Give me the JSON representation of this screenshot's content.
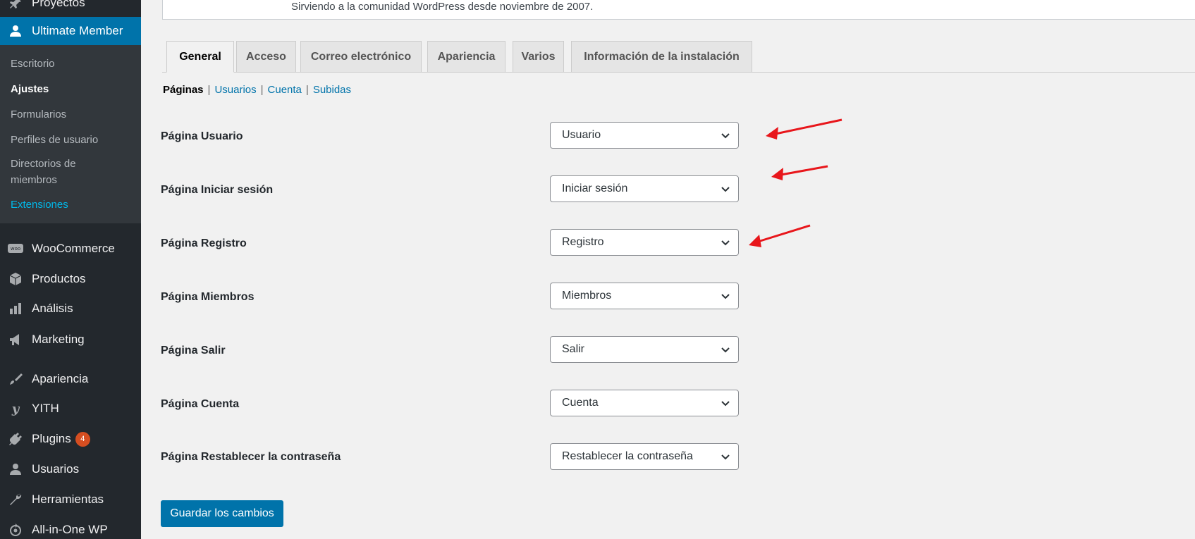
{
  "sidebar": {
    "top_items": [
      {
        "label": "Proyectos",
        "icon": "pin-icon"
      },
      {
        "label": "Ultimate Member",
        "icon": "user-icon"
      }
    ],
    "submenu": [
      {
        "label": "Escritorio"
      },
      {
        "label": "Ajustes"
      },
      {
        "label": "Formularios"
      },
      {
        "label": "Perfiles de usuario"
      },
      {
        "label": "Directorios de"
      },
      {
        "label": "miembros"
      },
      {
        "label": "Extensiones"
      }
    ],
    "items": [
      {
        "label": "WooCommerce",
        "icon": "woo-icon"
      },
      {
        "label": "Productos",
        "icon": "box-icon"
      },
      {
        "label": "Análisis",
        "icon": "bar-chart-icon"
      },
      {
        "label": "Marketing",
        "icon": "megaphone-icon"
      },
      {
        "label": "Apariencia",
        "icon": "paintbrush-icon"
      },
      {
        "label": "YITH",
        "icon": "yith-icon"
      },
      {
        "label": "Plugins",
        "icon": "plug-icon",
        "badge": "4"
      },
      {
        "label": "Usuarios",
        "icon": "user-icon"
      },
      {
        "label": "Herramientas",
        "icon": "wrench-icon"
      },
      {
        "label": "All-in-One WP",
        "icon": "circle-arrow-icon"
      }
    ]
  },
  "notice": {
    "text": "Sirviendo a la comunidad WordPress desde noviembre de 2007."
  },
  "tabs": [
    {
      "label": "General"
    },
    {
      "label": "Acceso"
    },
    {
      "label": "Correo electrónico"
    },
    {
      "label": "Apariencia"
    },
    {
      "label": "Varios"
    },
    {
      "label": "Información de la instalación"
    }
  ],
  "subnav": [
    {
      "label": "Páginas"
    },
    {
      "label": "Usuarios"
    },
    {
      "label": "Cuenta"
    },
    {
      "label": "Subidas"
    }
  ],
  "settings": [
    {
      "label": "Página Usuario",
      "value": "Usuario"
    },
    {
      "label": "Página Iniciar sesión",
      "value": "Iniciar sesión"
    },
    {
      "label": "Página Registro",
      "value": "Registro"
    },
    {
      "label": "Página Miembros",
      "value": "Miembros"
    },
    {
      "label": "Página Salir",
      "value": "Salir"
    },
    {
      "label": "Página Cuenta",
      "value": "Cuenta"
    },
    {
      "label": "Página Restablecer la contraseña",
      "value": "Restablecer la contraseña"
    }
  ],
  "save_button": "Guardar los cambios",
  "colors": {
    "accent": "#0073aa",
    "sidebar": "#23282d",
    "arrow": "#e8161b",
    "badge": "#d54e21"
  }
}
